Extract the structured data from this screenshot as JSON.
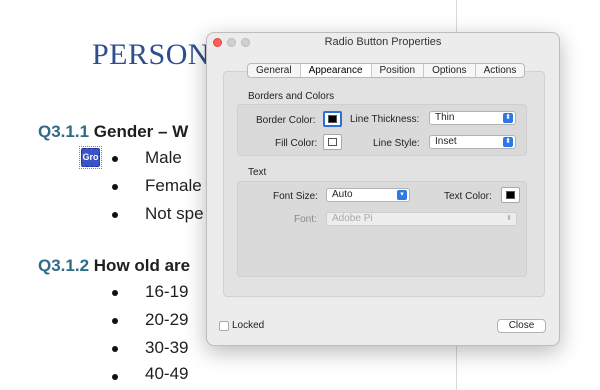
{
  "document": {
    "title": "PERSONA",
    "q1": {
      "num": "Q3.1.1",
      "text": "Gender – W"
    },
    "q1_items": [
      "Male",
      "Female",
      "Not spe"
    ],
    "q2": {
      "num": "Q3.1.2",
      "text": "How old are"
    },
    "q2_items": [
      "16-19",
      "20-29",
      "30-39",
      "40-49"
    ],
    "radio_field_label": "Gro"
  },
  "dialog": {
    "title": "Radio Button Properties",
    "tabs": [
      "General",
      "Appearance",
      "Position",
      "Options",
      "Actions"
    ],
    "active_tab": "Appearance",
    "borders_colors": {
      "heading": "Borders and Colors",
      "border_color_label": "Border Color:",
      "border_color": "#000000",
      "line_thickness_label": "Line Thickness:",
      "line_thickness_value": "Thin",
      "fill_color_label": "Fill Color:",
      "fill_color": "#ffffff",
      "line_style_label": "Line Style:",
      "line_style_value": "Inset"
    },
    "text_section": {
      "heading": "Text",
      "font_size_label": "Font Size:",
      "font_size_value": "Auto",
      "text_color_label": "Text Color:",
      "text_color": "#000000",
      "font_label": "Font:",
      "font_value": "Adobe Pi"
    },
    "locked_label": "Locked",
    "locked_checked": false,
    "close_label": "Close"
  },
  "colors": {
    "accent": "#2f78e6",
    "heading": "#2e4f8f",
    "qnum": "#2f6b86"
  }
}
